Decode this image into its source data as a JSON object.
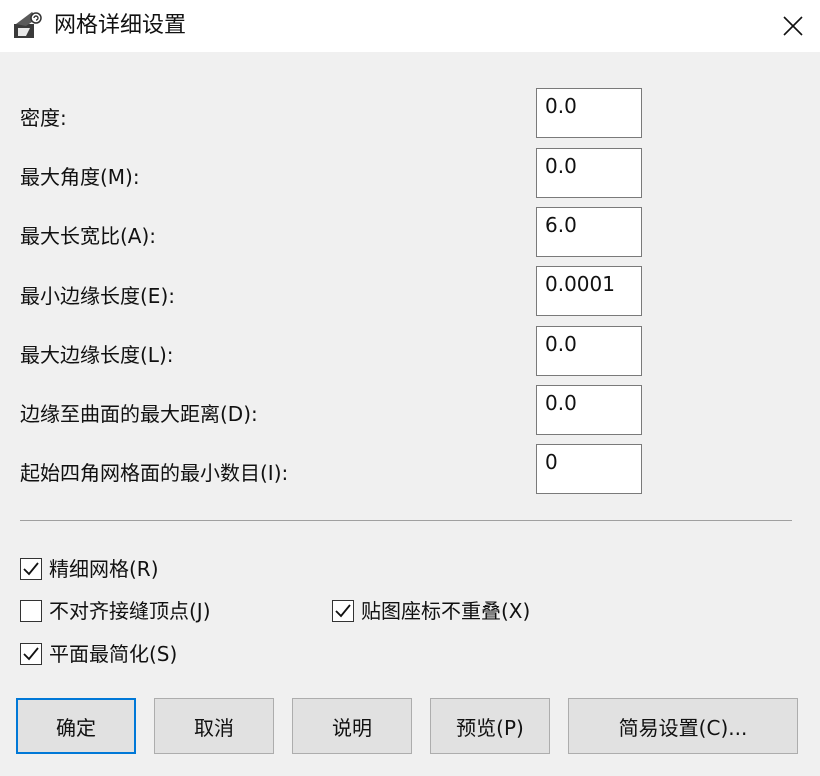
{
  "window": {
    "title": "网格详细设置",
    "icons": {
      "app": "rhino-app-icon",
      "close": "close-icon"
    }
  },
  "fields": [
    {
      "label": "密度:",
      "value": "0.0"
    },
    {
      "label": "最大角度(M):",
      "value": "0.0"
    },
    {
      "label": "最大长宽比(A):",
      "value": "6.0"
    },
    {
      "label": "最小边缘长度(E):",
      "value": "0.0001"
    },
    {
      "label": "最大边缘长度(L):",
      "value": "0.0"
    },
    {
      "label": "边缘至曲面的最大距离(D):",
      "value": "0.0"
    },
    {
      "label": "起始四角网格面的最小数目(I):",
      "value": "0"
    }
  ],
  "checkboxes": [
    {
      "label": "精细网格(R)",
      "checked": true
    },
    {
      "label": "不对齐接缝顶点(J)",
      "checked": false
    },
    {
      "label": "贴图座标不重叠(X)",
      "checked": true
    },
    {
      "label": "平面最简化(S)",
      "checked": true
    }
  ],
  "buttons": {
    "ok": "确定",
    "cancel": "取消",
    "help": "说明",
    "preview": "预览(P)",
    "simple": "简易设置(C)..."
  },
  "colors": {
    "default_button_border": "#0078d7"
  }
}
